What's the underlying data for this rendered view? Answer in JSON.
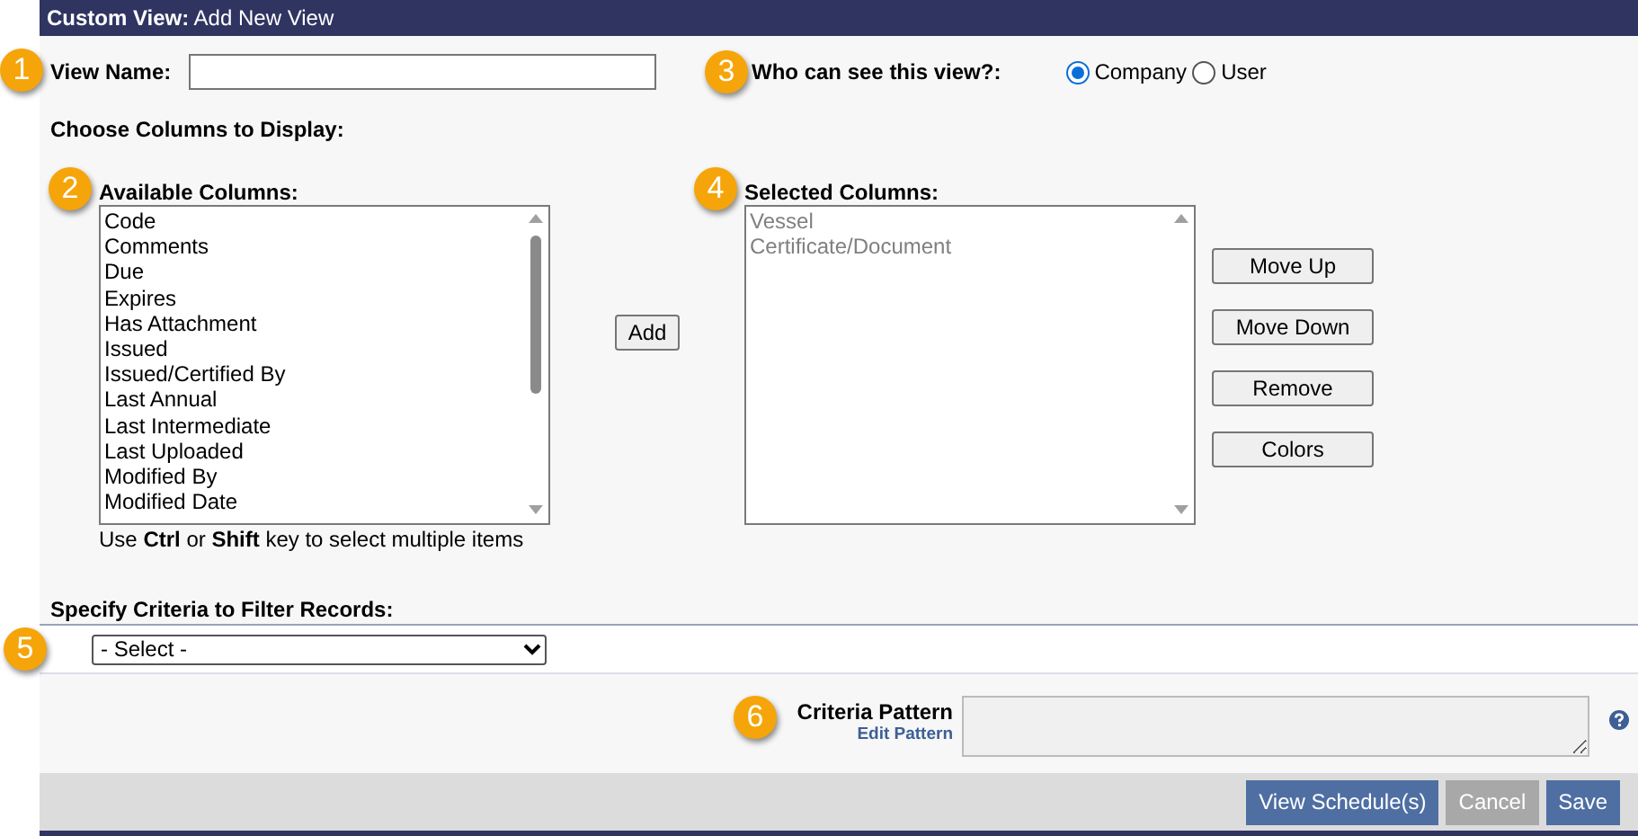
{
  "header": {
    "title": "**Custom View:** Add New View"
  },
  "view_name": {
    "badge": "1",
    "label": "View Name:"
  },
  "visibility": {
    "badge": "3",
    "label": "Who can see this view?:",
    "options": [
      {
        "label": "Company",
        "selected": true
      },
      {
        "label": "User",
        "selected": false
      }
    ]
  },
  "columns_heading": "Choose Columns to Display:",
  "available": {
    "badge": "2",
    "label": "Available Columns:",
    "items": [
      "Code",
      "Comments",
      "Due",
      "Expires",
      "Has Attachment",
      "Issued",
      "Issued/Certified By",
      "Last Annual",
      "Last Intermediate",
      "Last Uploaded",
      "Modified By",
      "Modified Date"
    ],
    "hint": "Use **Ctrl** or **Shift** key to select multiple items"
  },
  "add_button": "Add",
  "selected": {
    "badge": "4",
    "label": "Selected Columns:",
    "items": [
      "Vessel",
      "Certificate/Document"
    ]
  },
  "side_buttons": [
    "Move Up",
    "Move Down",
    "Remove",
    "Colors"
  ],
  "criteria": {
    "label": "Specify Criteria to Filter Records:",
    "badge": "5",
    "select": "- Select -"
  },
  "pattern": {
    "badge": "6",
    "label": "Criteria Pattern",
    "link": "Edit Pattern"
  },
  "footer_buttons": [
    {
      "label": "View Schedule(s)",
      "kind": "primary"
    },
    {
      "label": "Cancel",
      "kind": "secondary"
    },
    {
      "label": "Save",
      "kind": "primary"
    }
  ]
}
